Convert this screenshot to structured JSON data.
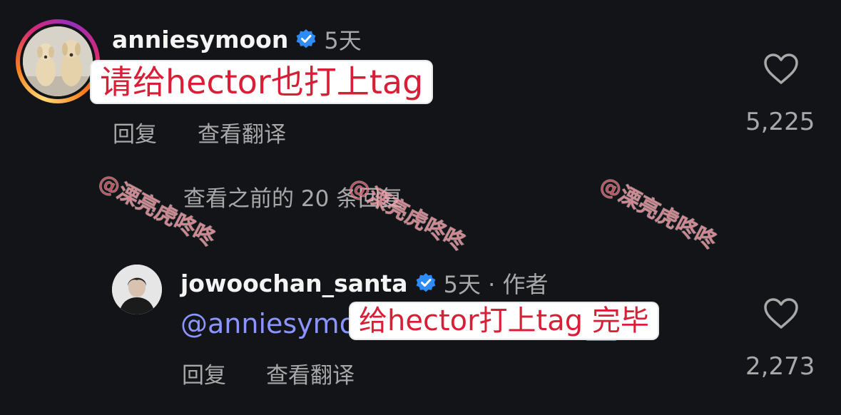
{
  "comment": {
    "username": "anniesymoon",
    "time": "5天",
    "text": "请给hector也打上tag",
    "reply_label": "回复",
    "translate_label": "查看翻译",
    "like_count": "5,225"
  },
  "view_previous": "查看之前的 20 条回复",
  "reply": {
    "username": "jowoochan_santa",
    "time": "5天 · 作者",
    "mention": "@anniesymo",
    "text": "给hector打上tag 完毕",
    "reply_label": "回复",
    "translate_label": "查看翻译",
    "like_count": "2,273"
  },
  "watermark": "@溧亮虎咚咚",
  "colors": {
    "background": "#131417",
    "verified": "#2f8cf7",
    "bubble_text": "#d81f37",
    "mention": "#8a95ff"
  },
  "icons": [
    "verified-badge-icon",
    "heart-icon"
  ]
}
